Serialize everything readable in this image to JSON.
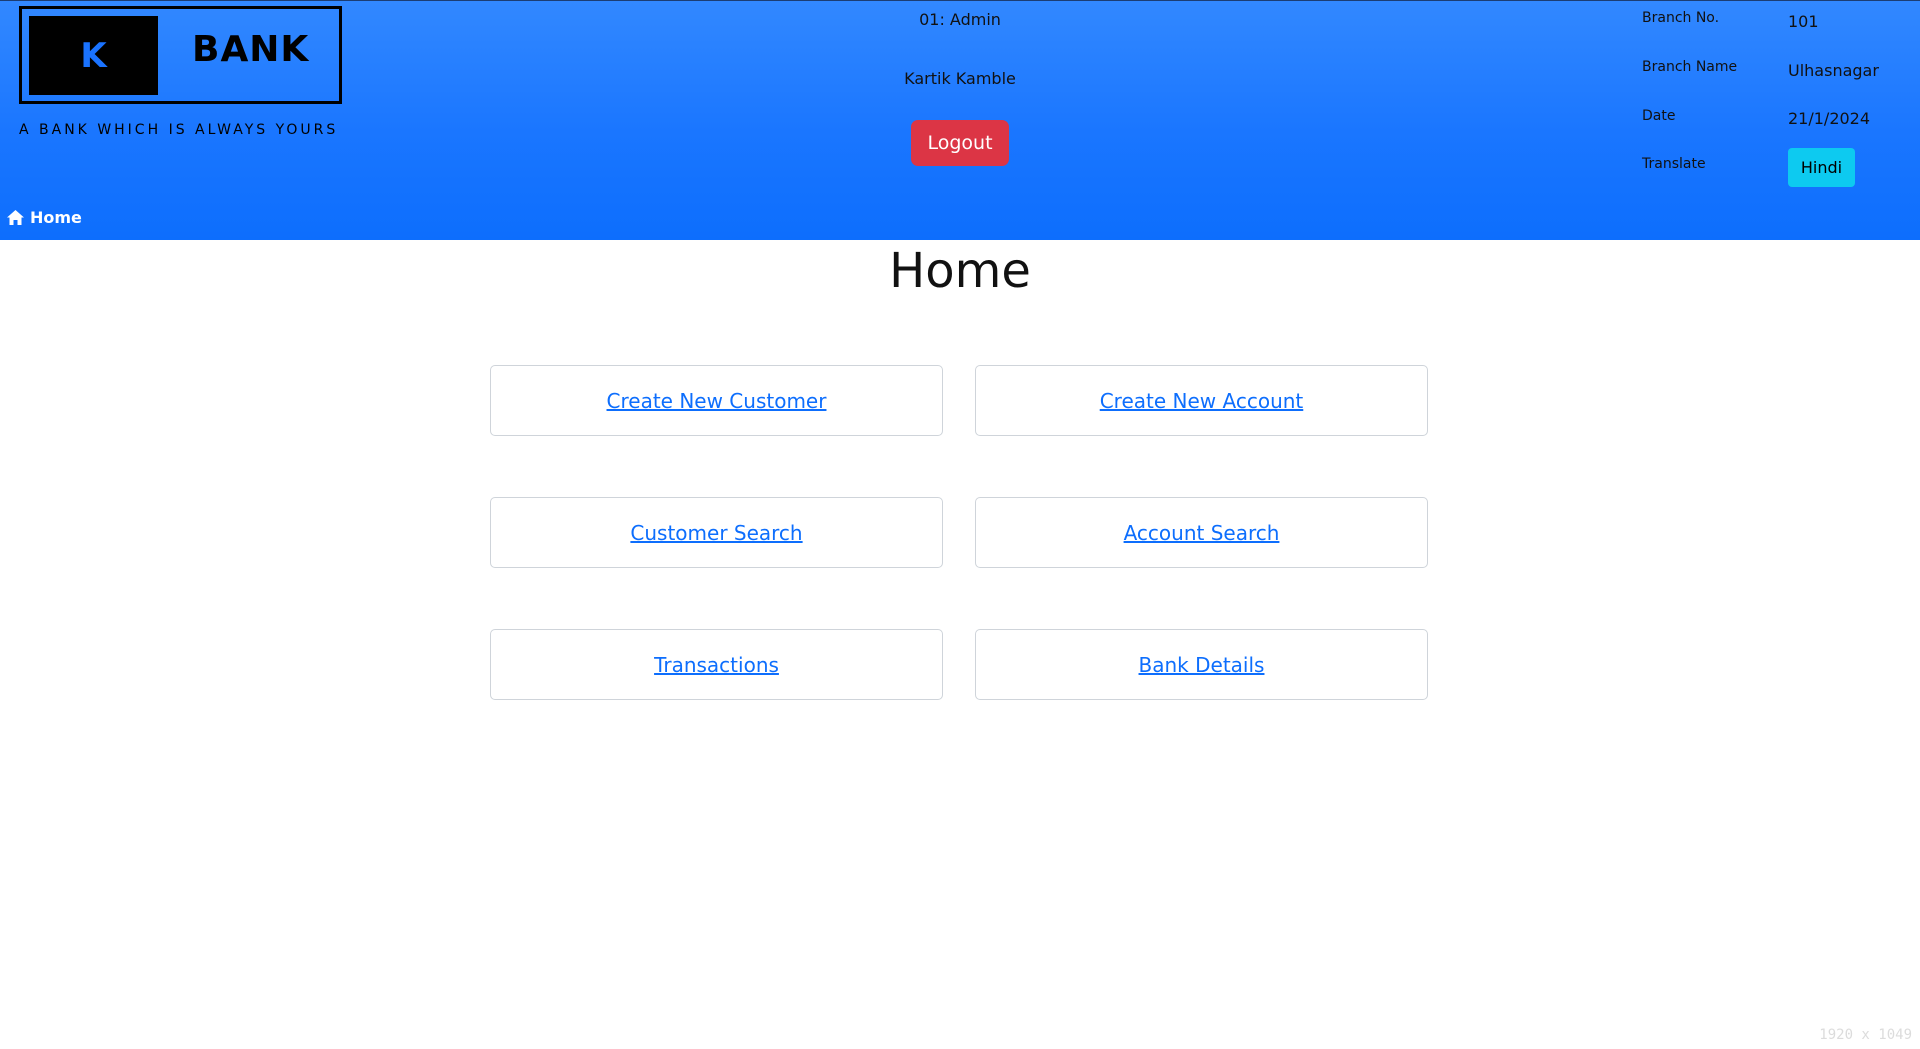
{
  "logo": {
    "letter": "K",
    "name": "BANK",
    "tagline": "A BANK WHICH IS ALWAYS YOURS"
  },
  "user": {
    "role": "01: Admin",
    "name": "Kartik Kamble",
    "logout_label": "Logout"
  },
  "branch_info": {
    "branch_no_label": "Branch No.",
    "branch_no_value": "101",
    "branch_name_label": "Branch Name",
    "branch_name_value": "Ulhasnagar",
    "date_label": "Date",
    "date_value": "21/1/2024",
    "translate_label": "Translate",
    "translate_button": "Hindi"
  },
  "breadcrumb": {
    "label": "Home",
    "icon": "home-icon"
  },
  "page": {
    "title": "Home"
  },
  "actions": [
    {
      "label": "Create New Customer"
    },
    {
      "label": "Create New Account"
    },
    {
      "label": "Customer Search"
    },
    {
      "label": "Account Search"
    },
    {
      "label": "Transactions"
    },
    {
      "label": "Bank Details"
    }
  ],
  "watermark": "1920 x 1049",
  "colors": {
    "header": "#1a76ff",
    "logout": "#dc3545",
    "translate": "#0dcaf0",
    "link": "#0d6efd"
  }
}
